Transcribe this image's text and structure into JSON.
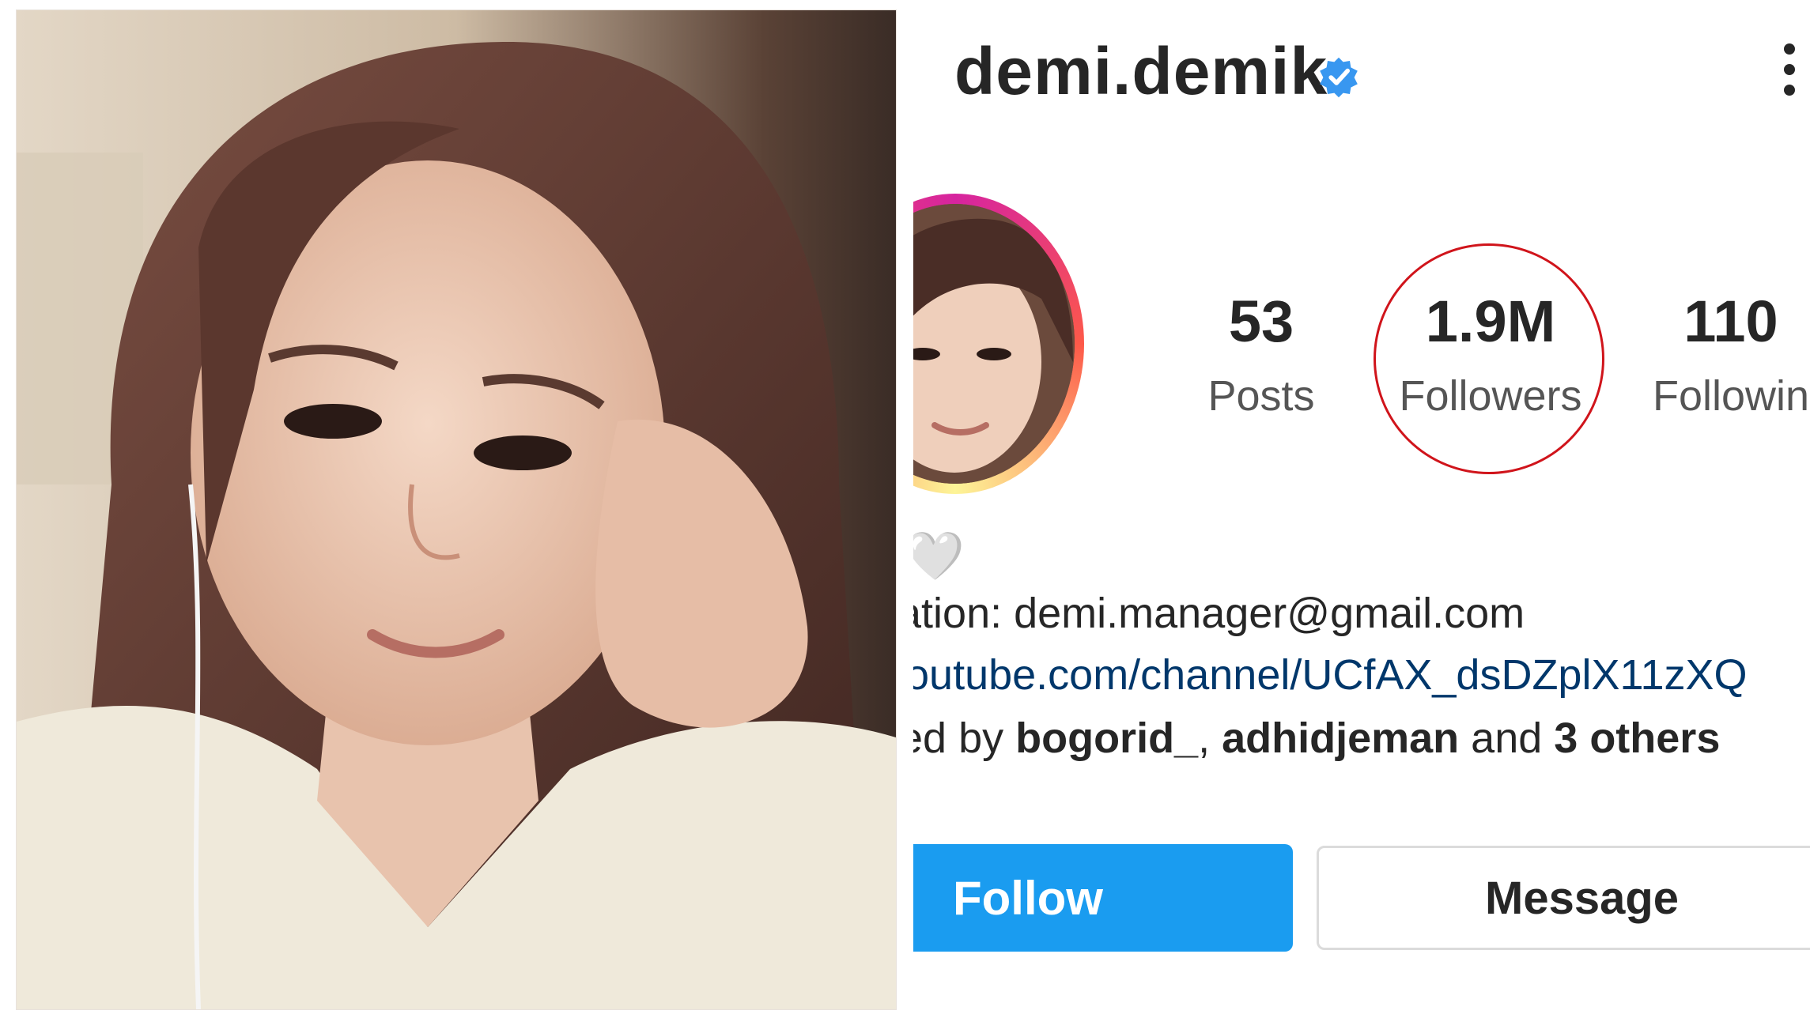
{
  "profile": {
    "username": "demi.demik",
    "verified_icon": "verified-badge-icon",
    "menu_icon": "more-options-icon"
  },
  "stats": [
    {
      "value": "53",
      "label": "Posts"
    },
    {
      "value": "1.9M",
      "label": "Followers"
    },
    {
      "value": "110",
      "label": "Followin"
    }
  ],
  "bio": {
    "heart": "🤍",
    "email_prefix": "ation: ",
    "email": "demi.manager@gmail.com",
    "link": "outube.com/channel/UCfAX_dsDZplX11zXQ",
    "followed_prefix": "ed by ",
    "follower1": "bogorid_",
    "sep": ", ",
    "follower2": "adhidjeman",
    "and_text": " and ",
    "others": "3 others"
  },
  "actions": {
    "follow_label": "Follow",
    "message_label": "Message"
  },
  "colors": {
    "follow_blue": "#1a9cf0",
    "verified_blue": "#3897f0",
    "highlight_red": "#d0141b"
  }
}
